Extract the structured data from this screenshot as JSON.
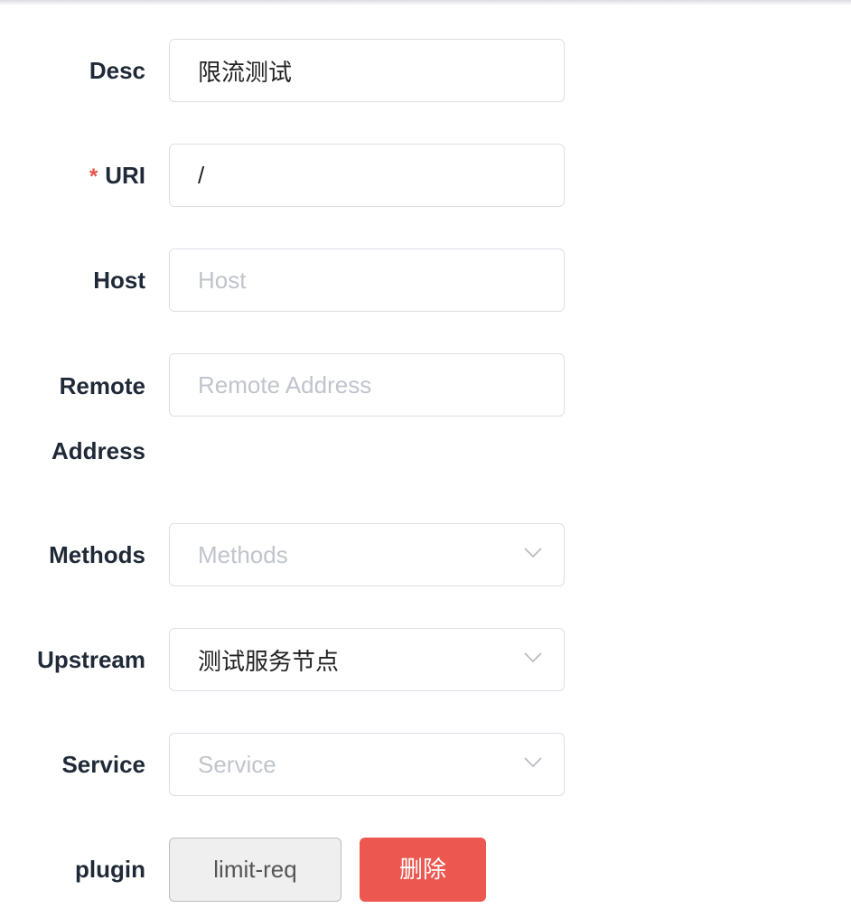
{
  "form": {
    "desc": {
      "label": "Desc",
      "value": "限流测试",
      "placeholder": ""
    },
    "uri": {
      "label": "URI",
      "required_mark": "*",
      "value": "/",
      "placeholder": ""
    },
    "host": {
      "label": "Host",
      "value": "",
      "placeholder": "Host"
    },
    "remote_address": {
      "label_line1": "Remote",
      "label_line2": "Address",
      "value": "",
      "placeholder": "Remote Address"
    },
    "methods": {
      "label": "Methods",
      "value": "",
      "placeholder": "Methods",
      "icon": "chevron-down-icon"
    },
    "upstream": {
      "label": "Upstream",
      "value": "测试服务节点",
      "placeholder": "",
      "icon": "chevron-down-icon"
    },
    "service": {
      "label": "Service",
      "value": "",
      "placeholder": "Service",
      "icon": "chevron-down-icon"
    },
    "plugin": {
      "label": "plugin",
      "plugin_name": "limit-req",
      "delete_label": "删除"
    }
  },
  "colors": {
    "required": "#e5534b",
    "delete_button": "#ec5750",
    "border": "#dcdfe6"
  }
}
